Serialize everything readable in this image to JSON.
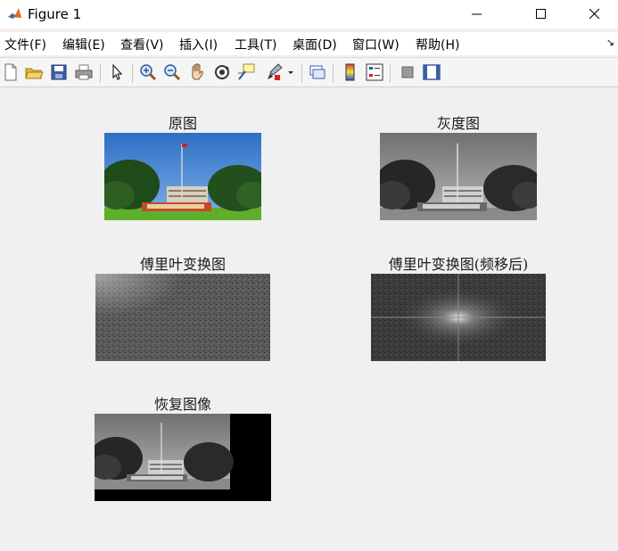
{
  "window": {
    "title": "Figure 1"
  },
  "menu": {
    "items": [
      "文件(F)",
      "编辑(E)",
      "查看(V)",
      "插入(I)",
      "工具(T)",
      "桌面(D)",
      "窗口(W)",
      "帮助(H)"
    ]
  },
  "toolbar": {
    "tools": [
      "new-figure-icon",
      "open-file-icon",
      "save-icon",
      "print-icon",
      "pointer-icon",
      "zoom-in-icon",
      "zoom-out-icon",
      "pan-icon",
      "rotate-3d-icon",
      "data-cursor-icon",
      "brush-icon",
      "link-plot-icon",
      "colorbar-icon",
      "legend-icon",
      "hide-plot-tools-icon",
      "show-plot-tools-icon"
    ]
  },
  "figures": {
    "original": {
      "title": "原图"
    },
    "grayscale": {
      "title": "灰度图"
    },
    "fft": {
      "title": "傅里叶变换图"
    },
    "fft_shifted": {
      "title": "傅里叶变换图(频移后)"
    },
    "restored": {
      "title": "恢复图像"
    }
  },
  "colors": {
    "sky": "#3a78c8",
    "grass": "#5fae2c",
    "matlab_bg": "#f0f0f0"
  }
}
